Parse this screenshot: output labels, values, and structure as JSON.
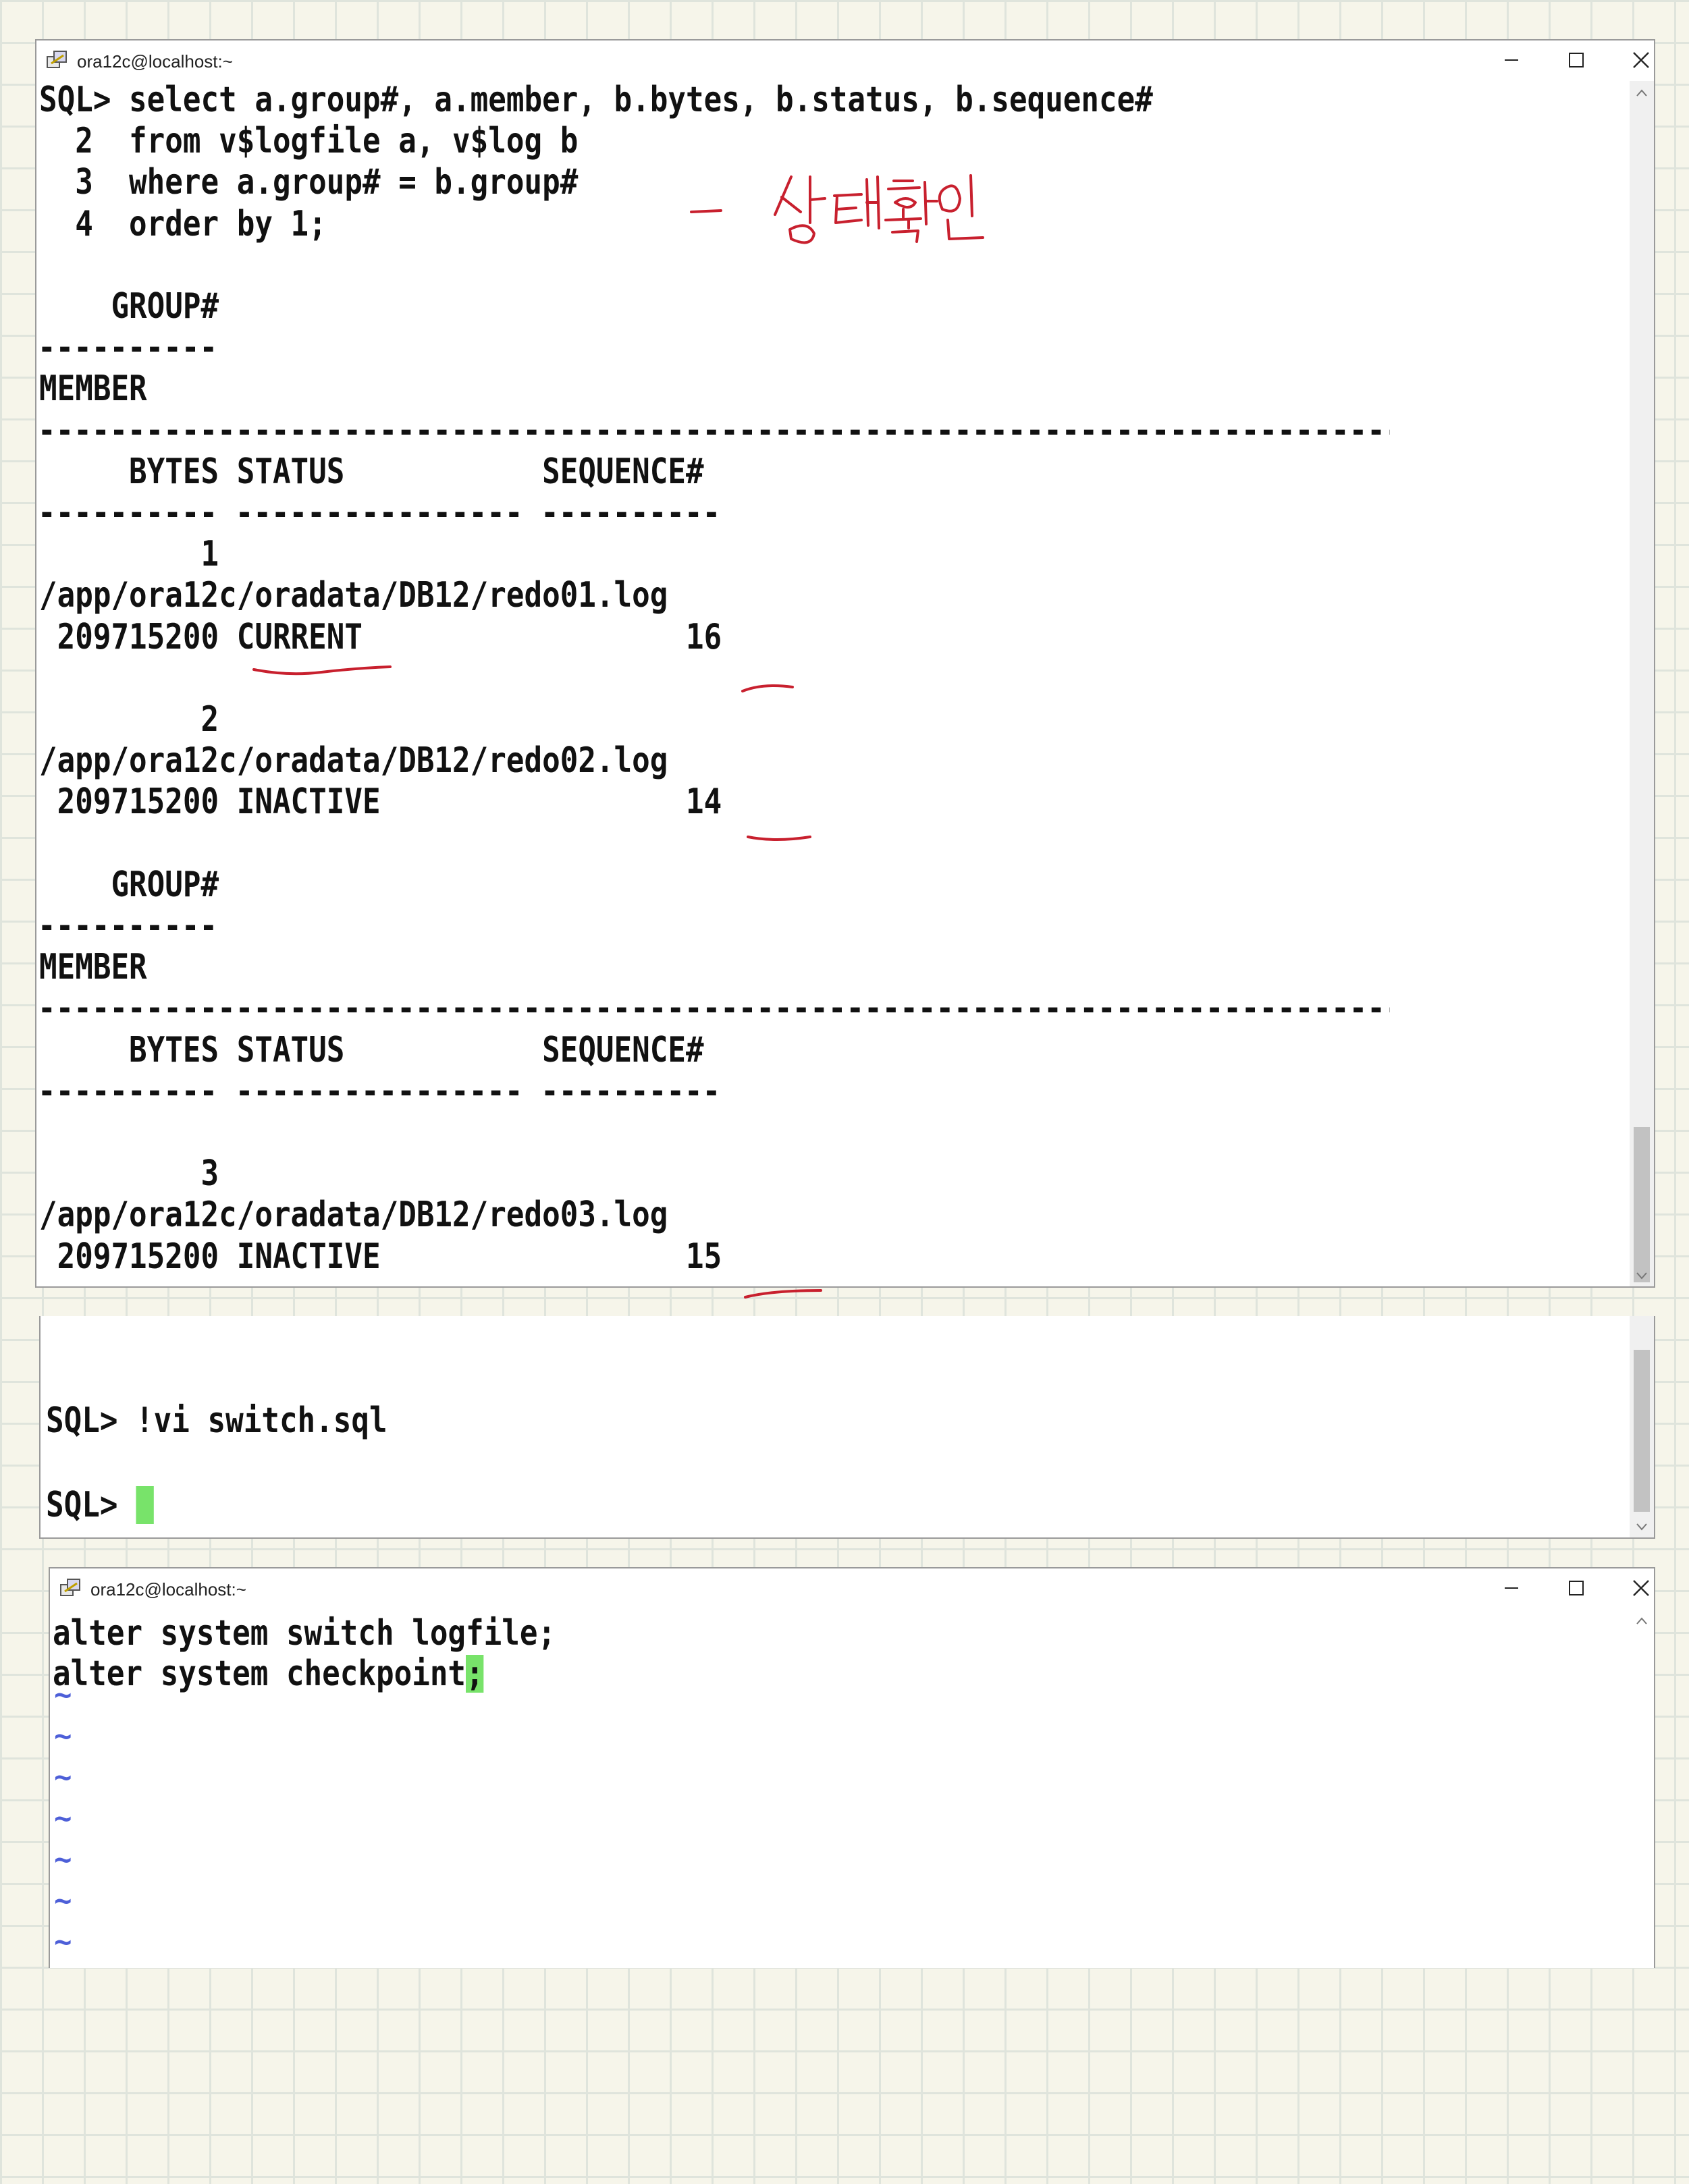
{
  "window1": {
    "title": "ora12c@localhost:~",
    "lines": [
      "SQL> select a.group#, a.member, b.bytes, b.status, b.sequence#",
      "  2  from v$logfile a, v$log b",
      "  3  where a.group# = b.group#",
      "  4  order by 1;",
      "",
      "    GROUP#",
      "----------",
      "MEMBER",
      "--------------------------------------------------------------------------------",
      "     BYTES STATUS           SEQUENCE#",
      "---------- ---------------- ----------",
      "         1",
      "/app/ora12c/oradata/DB12/redo01.log",
      " 209715200 CURRENT                  16",
      "",
      "         2",
      "/app/ora12c/oradata/DB12/redo02.log",
      " 209715200 INACTIVE                 14",
      "",
      "    GROUP#",
      "----------",
      "MEMBER",
      "--------------------------------------------------------------------------------",
      "     BYTES STATUS           SEQUENCE#",
      "---------- ---------------- ----------",
      "",
      "         3",
      "/app/ora12c/oradata/DB12/redo03.log",
      " 209715200 INACTIVE                 15"
    ]
  },
  "window2": {
    "lines": [
      "",
      "",
      "SQL> !vi switch.sql",
      "",
      "SQL> "
    ]
  },
  "window3": {
    "title": "ora12c@localhost:~",
    "lines": [
      "alter system switch logfile;",
      "alter system checkpoint"
    ],
    "cursor_char": ";",
    "tilde": "~"
  },
  "annotation": {
    "text": "- 상태확인",
    "color": "#c8202e"
  },
  "colors": {
    "cursor": "#78e36a",
    "tilde": "#4d5fd8",
    "grid": "#dfe4dc"
  }
}
